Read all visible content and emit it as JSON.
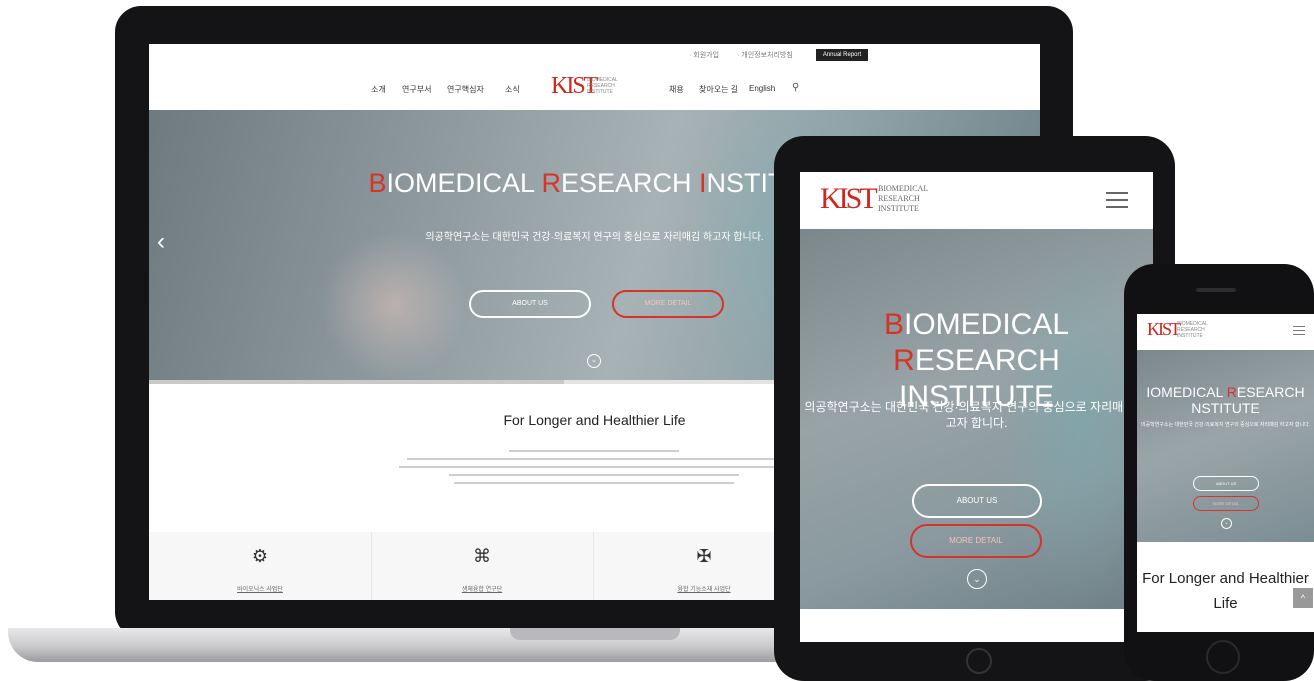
{
  "colors": {
    "accent": "#d53427",
    "link": "#1e5fb8",
    "device": "#141416"
  },
  "desktop": {
    "topbar": {
      "util_1": "· 회원가입",
      "util_2": "· 개인정보처리방침",
      "annual_button": "Annual Report"
    },
    "nav": {
      "items": [
        "소개",
        "연구부서",
        "연구핵심자",
        "소식"
      ],
      "right_items": [
        "채용",
        "찾아오는 길",
        "English"
      ],
      "logo_text": "KIST",
      "logo_sub": "BIOMEDICAL RESEARCH INSTITUTE",
      "search_icon": "search-icon"
    },
    "hero": {
      "title_parts": [
        "B",
        "IOMEDICAL ",
        "R",
        "ESEARCH ",
        "I",
        "NSTITUT"
      ],
      "subtitle": "의공학연구소는 대한민국 건강·의료복지 연구의 중심으로 자리매김 하고자 합니다.",
      "about_button": "ABOUT US",
      "more_button": "MORE DETAIL",
      "prev_icon": "chevron-left-icon",
      "down_icon": "chevron-down-circle-icon"
    },
    "intro": {
      "title": "For Longer and Healthier Life"
    },
    "features": [
      {
        "icon": "chip-icon",
        "label": "바이오닉스 사업단"
      },
      {
        "icon": "command-icon",
        "label": "생체융합 연구단"
      },
      {
        "icon": "capsule-icon",
        "label": "융합 기능소재 사업단"
      }
    ]
  },
  "tablet": {
    "logo_text": "KIST",
    "logo_sub": "BIOMEDICAL RESEARCH INSTITUTE",
    "menu_icon": "hamburger-menu-icon",
    "title_line1_parts": [
      "B",
      "IOMEDICAL ",
      "R",
      "ESEARCH"
    ],
    "title_line2": "INSTITUTE",
    "subtitle": "의공학연구소는 대한민국 건강·의료복지 연구의 중심으로 자리매김 하고자 합니다.",
    "about_button": "ABOUT US",
    "more_button": "MORE DETAIL"
  },
  "phone": {
    "logo_text": "KIST",
    "logo_sub": "BIOMEDICAL RESEARCH INSTITUTE",
    "menu_icon": "hamburger-menu-icon",
    "title_line1_parts": [
      "IOMEDICAL ",
      "R",
      "ESEARCH"
    ],
    "title_line2": "NSTITUTE",
    "subtitle": "의공학연구소는 대한민국 건강·의료복지 연구의 중심으로 자리매김 하고자 합니다.",
    "about_button": "ABOUT US",
    "more_button": "MORE DETAIL",
    "intro_title": "For Longer and Healthier Life",
    "top_button": "^"
  }
}
